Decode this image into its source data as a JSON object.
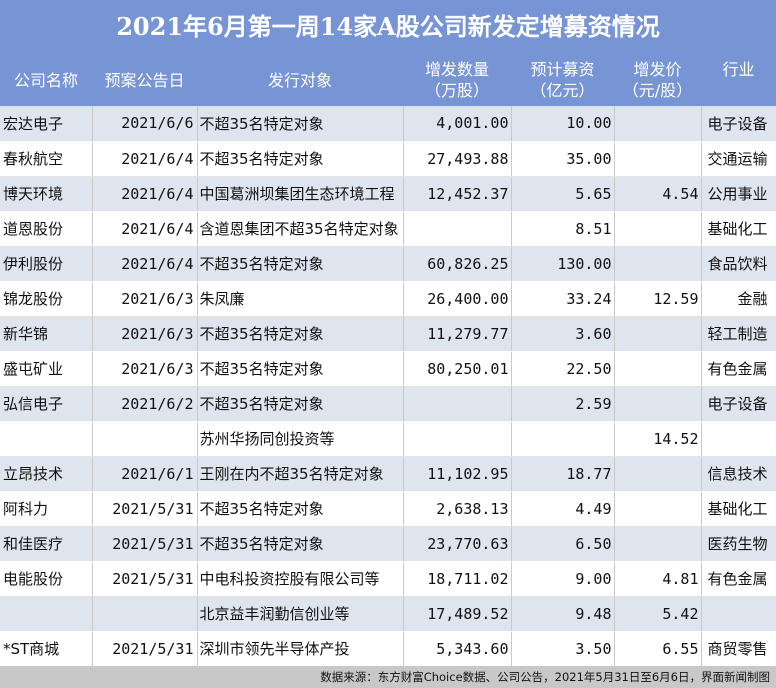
{
  "title": "2021年6月第一周14家A股公司新发定增募资情况",
  "columns": {
    "company": "公司名称",
    "date": "预案公告日",
    "target": "发行对象",
    "shares": [
      "增发数量",
      "（万股）"
    ],
    "amount": [
      "预计募资",
      "（亿元）"
    ],
    "price": [
      "增发价",
      "（元/股）"
    ],
    "industry": "行业"
  },
  "rows": [
    {
      "company": "宏达电子",
      "date": "2021/6/6",
      "target": "不超35名特定对象",
      "shares": "4,001.00",
      "amount": "10.00",
      "price": "",
      "industry": "电子设备"
    },
    {
      "company": "春秋航空",
      "date": "2021/6/4",
      "target": "不超35名特定对象",
      "shares": "27,493.88",
      "amount": "35.00",
      "price": "",
      "industry": "交通运输"
    },
    {
      "company": "博天环境",
      "date": "2021/6/4",
      "target": "中国葛洲坝集团生态环境工程",
      "shares": "12,452.37",
      "amount": "5.65",
      "price": "4.54",
      "industry": "公用事业"
    },
    {
      "company": "道恩股份",
      "date": "2021/6/4",
      "target": "含道恩集团不超35名特定对象",
      "shares": "",
      "amount": "8.51",
      "price": "",
      "industry": "基础化工"
    },
    {
      "company": "伊利股份",
      "date": "2021/6/4",
      "target": "不超35名特定对象",
      "shares": "60,826.25",
      "amount": "130.00",
      "price": "",
      "industry": "食品饮料"
    },
    {
      "company": "锦龙股份",
      "date": "2021/6/3",
      "target": "朱凤廉",
      "shares": "26,400.00",
      "amount": "33.24",
      "price": "12.59",
      "industry": "金融"
    },
    {
      "company": "新华锦",
      "date": "2021/6/3",
      "target": "不超35名特定对象",
      "shares": "11,279.77",
      "amount": "3.60",
      "price": "",
      "industry": "轻工制造"
    },
    {
      "company": "盛屯矿业",
      "date": "2021/6/3",
      "target": "不超35名特定对象",
      "shares": "80,250.01",
      "amount": "22.50",
      "price": "",
      "industry": "有色金属"
    },
    {
      "company": "弘信电子",
      "date": "2021/6/2",
      "target": "不超35名特定对象",
      "shares": "",
      "amount": "2.59",
      "price": "",
      "industry": "电子设备"
    },
    {
      "company": "",
      "date": "",
      "target": "苏州华扬同创投资等",
      "shares": "",
      "amount": "",
      "price": "14.52",
      "industry": ""
    },
    {
      "company": "立昂技术",
      "date": "2021/6/1",
      "target": "王刚在内不超35名特定对象",
      "shares": "11,102.95",
      "amount": "18.77",
      "price": "",
      "industry": "信息技术"
    },
    {
      "company": "阿科力",
      "date": "2021/5/31",
      "target": "不超35名特定对象",
      "shares": "2,638.13",
      "amount": "4.49",
      "price": "",
      "industry": "基础化工"
    },
    {
      "company": "和佳医疗",
      "date": "2021/5/31",
      "target": "不超35名特定对象",
      "shares": "23,770.63",
      "amount": "6.50",
      "price": "",
      "industry": "医药生物"
    },
    {
      "company": "电能股份",
      "date": "2021/5/31",
      "target": "中电科投资控股有限公司等",
      "shares": "18,711.02",
      "amount": "9.00",
      "price": "4.81",
      "industry": "有色金属"
    },
    {
      "company": "",
      "date": "",
      "target": "北京益丰润勤信创业等",
      "shares": "17,489.52",
      "amount": "9.48",
      "price": "5.42",
      "industry": ""
    },
    {
      "company": "*ST商城",
      "date": "2021/5/31",
      "target": "深圳市领先半导体产投",
      "shares": "5,343.60",
      "amount": "3.50",
      "price": "6.55",
      "industry": "商贸零售"
    }
  ],
  "footer": "数据来源：东方财富Choice数据、公司公告，2021年5月31日至6月6日，界面新闻制图"
}
